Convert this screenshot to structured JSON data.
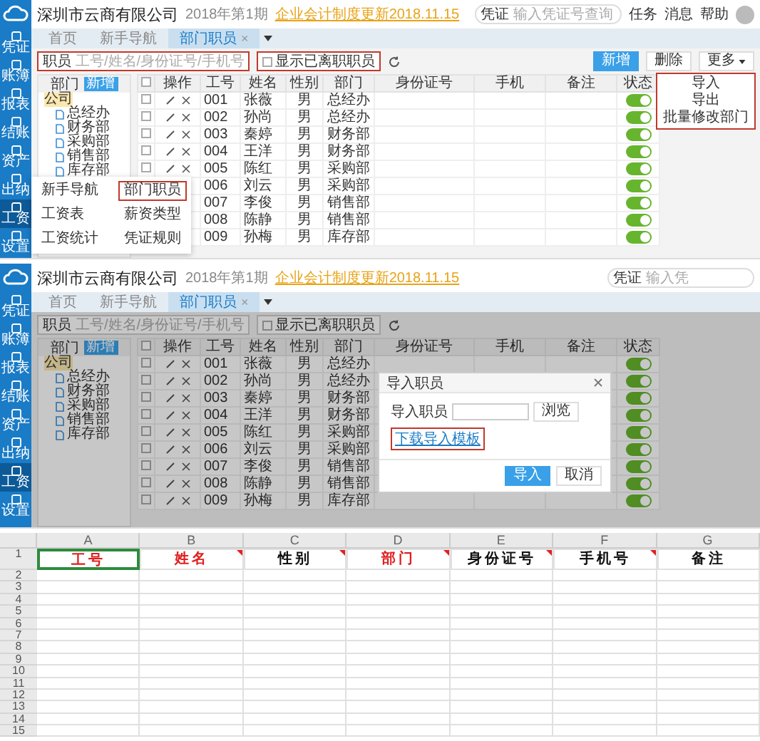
{
  "screens": [
    {
      "kind": "app",
      "dimmed": false,
      "company": "深圳市云商有限公司",
      "period": "2018年第1期",
      "notice": "企业会计制度更新2018.11.15",
      "header_search": {
        "select": "凭证",
        "placeholder": "输入凭证号查询"
      },
      "header_links": [
        "任务",
        "消息",
        "帮助"
      ],
      "sidebar": [
        {
          "label": "凭证",
          "selected": false
        },
        {
          "label": "账簿",
          "selected": false
        },
        {
          "label": "报表",
          "selected": false
        },
        {
          "label": "结账",
          "selected": false
        },
        {
          "label": "资产",
          "selected": false
        },
        {
          "label": "出纳",
          "selected": false
        },
        {
          "label": "工资",
          "selected": true
        },
        {
          "label": "设置",
          "selected": false
        }
      ],
      "tabs": [
        {
          "label": "首页",
          "selected": false
        },
        {
          "label": "新手导航",
          "selected": false
        },
        {
          "label": "部门职员",
          "selected": true,
          "close": "×"
        }
      ],
      "toolbar": {
        "label": "职员",
        "placeholder": "工号/姓名/身份证号/手机号",
        "search_highlighted": true,
        "checkbox": {
          "label": "显示已离职职员",
          "checked": false,
          "highlighted": true
        },
        "buttons": [
          {
            "label": "新增",
            "kind": "primary"
          },
          {
            "label": "删除",
            "kind": "default"
          },
          {
            "label": "更多",
            "kind": "menu"
          }
        ]
      },
      "dropdown": {
        "highlighted": true,
        "items": [
          "导入",
          "导出",
          "批量修改部门"
        ]
      },
      "tree": {
        "title": "部门",
        "action": "新增",
        "nodes": [
          {
            "label": "公司",
            "children": [
              {
                "label": "总经办"
              },
              {
                "label": "财务部"
              },
              {
                "label": "采购部"
              },
              {
                "label": "销售部"
              },
              {
                "label": "库存部"
              }
            ]
          }
        ]
      },
      "table": {
        "all_checked": false,
        "columns": [
          "操作",
          "工号",
          "姓名",
          "性别",
          "部门",
          "身份证号",
          "手机",
          "备注",
          "状态"
        ],
        "rows": [
          {
            "id": "001",
            "name": "张薇",
            "gender": "男",
            "dept": "总经办",
            "checked": false,
            "on": true
          },
          {
            "id": "002",
            "name": "孙尚",
            "gender": "男",
            "dept": "总经办",
            "checked": false,
            "on": true
          },
          {
            "id": "003",
            "name": "秦婷",
            "gender": "男",
            "dept": "财务部",
            "checked": false,
            "on": true
          },
          {
            "id": "004",
            "name": "王洋",
            "gender": "男",
            "dept": "财务部",
            "checked": false,
            "on": true
          },
          {
            "id": "005",
            "name": "陈红",
            "gender": "男",
            "dept": "采购部",
            "checked": false,
            "on": true
          },
          {
            "id": "006",
            "name": "刘云",
            "gender": "男",
            "dept": "采购部",
            "on": true
          },
          {
            "id": "007",
            "name": "李俊",
            "gender": "男",
            "dept": "销售部",
            "on": true
          },
          {
            "id": "008",
            "name": "陈静",
            "gender": "男",
            "dept": "销售部",
            "on": true
          },
          {
            "id": "009",
            "name": "孙梅",
            "gender": "男",
            "dept": "库存部",
            "on": true
          }
        ]
      },
      "flyout": {
        "columns": [
          [
            {
              "label": "新手导航",
              "highlighted": false
            },
            {
              "label": "工资表",
              "highlighted": false
            },
            {
              "label": "工资统计",
              "highlighted": false
            }
          ],
          [
            {
              "label": "部门职员",
              "highlighted": true
            },
            {
              "label": "薪资类型",
              "highlighted": false
            },
            {
              "label": "凭证规则",
              "highlighted": false
            }
          ]
        ]
      }
    },
    {
      "kind": "app",
      "dimmed": true,
      "company": "深圳市云商有限公司",
      "period": "2018年第1期",
      "notice": "企业会计制度更新2018.11.15",
      "header_search": {
        "select": "凭证",
        "placeholder": "输入凭"
      },
      "sidebar": [
        {
          "label": "凭证",
          "selected": false
        },
        {
          "label": "账簿",
          "selected": false
        },
        {
          "label": "报表",
          "selected": false
        },
        {
          "label": "结账",
          "selected": false
        },
        {
          "label": "资产",
          "selected": false
        },
        {
          "label": "出纳",
          "selected": false
        },
        {
          "label": "工资",
          "selected": true
        },
        {
          "label": "设置",
          "selected": false
        }
      ],
      "tabs": [
        {
          "label": "首页",
          "selected": false
        },
        {
          "label": "新手导航",
          "selected": false
        },
        {
          "label": "部门职员",
          "selected": true,
          "close": "×"
        }
      ],
      "toolbar": {
        "label": "职员",
        "placeholder": "工号/姓名/身份证号/手机号",
        "search_highlighted": false,
        "checkbox": {
          "label": "显示已离职职员",
          "checked": false,
          "highlighted": false
        }
      },
      "tree": {
        "title": "部门",
        "action": "新增",
        "nodes": [
          {
            "label": "公司",
            "children": [
              {
                "label": "总经办"
              },
              {
                "label": "财务部"
              },
              {
                "label": "采购部"
              },
              {
                "label": "销售部"
              },
              {
                "label": "库存部"
              }
            ]
          }
        ]
      },
      "table": {
        "all_checked": false,
        "columns": [
          "操作",
          "工号",
          "姓名",
          "性别",
          "部门",
          "身份证号",
          "手机",
          "备注",
          "状态"
        ],
        "rows": [
          {
            "id": "001",
            "name": "张薇",
            "gender": "男",
            "dept": "总经办",
            "checked": false,
            "on": true
          },
          {
            "id": "002",
            "name": "孙尚",
            "gender": "男",
            "dept": "总经办",
            "checked": false,
            "on": true
          },
          {
            "id": "003",
            "name": "秦婷",
            "gender": "男",
            "dept": "财务部",
            "checked": false,
            "on": true
          },
          {
            "id": "004",
            "name": "王洋",
            "gender": "男",
            "dept": "财务部",
            "checked": false,
            "on": true
          },
          {
            "id": "005",
            "name": "陈红",
            "gender": "男",
            "dept": "采购部",
            "checked": false,
            "on": true
          },
          {
            "id": "006",
            "name": "刘云",
            "gender": "男",
            "dept": "采购部",
            "checked": false,
            "on": true
          },
          {
            "id": "007",
            "name": "李俊",
            "gender": "男",
            "dept": "销售部",
            "checked": false,
            "on": true
          },
          {
            "id": "008",
            "name": "陈静",
            "gender": "男",
            "dept": "销售部",
            "checked": false,
            "on": true
          },
          {
            "id": "009",
            "name": "孙梅",
            "gender": "男",
            "dept": "库存部",
            "checked": false,
            "on": true
          }
        ]
      },
      "dialog": {
        "title": "导入职员",
        "field_label": "导入职员",
        "browse": "浏览",
        "link": "下载导入模板",
        "link_highlighted": true,
        "buttons": [
          {
            "label": "导入",
            "kind": "primary"
          },
          {
            "label": "取消",
            "kind": "default"
          }
        ]
      }
    }
  ],
  "spreadsheet": {
    "columns": [
      {
        "letter": "A",
        "header": "工号",
        "color": "#e02020",
        "selected": true,
        "comment": false
      },
      {
        "letter": "B",
        "header": "姓名",
        "color": "#e02020",
        "selected": false,
        "comment": true
      },
      {
        "letter": "C",
        "header": "性别",
        "color": "#111111",
        "selected": false,
        "comment": true
      },
      {
        "letter": "D",
        "header": "部门",
        "color": "#e02020",
        "selected": false,
        "comment": true
      },
      {
        "letter": "E",
        "header": "身份证号",
        "color": "#111111",
        "selected": false,
        "comment": true
      },
      {
        "letter": "F",
        "header": "手机号",
        "color": "#111111",
        "selected": false,
        "comment": true
      },
      {
        "letter": "G",
        "header": "备注",
        "color": "#111111",
        "selected": false,
        "comment": false
      }
    ],
    "rows": [
      "1",
      "2",
      "3",
      "4",
      "5",
      "6",
      "7",
      "8",
      "9",
      "10",
      "11",
      "12",
      "13",
      "14",
      "15"
    ]
  }
}
